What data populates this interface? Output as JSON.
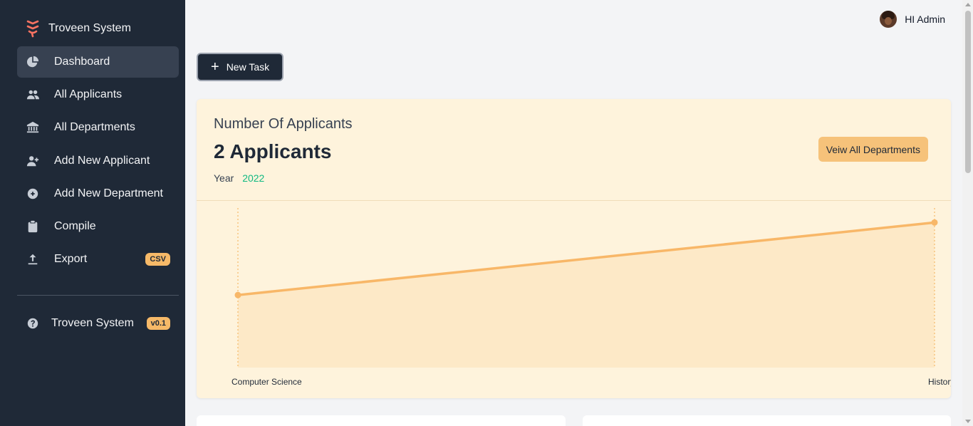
{
  "brand": {
    "name": "Troveen System",
    "logo_icon": "troveen-logo-icon"
  },
  "sidebar": {
    "items": [
      {
        "label": "Dashboard",
        "icon": "pie-chart-icon",
        "active": true
      },
      {
        "label": "All Applicants",
        "icon": "users-icon"
      },
      {
        "label": "All Departments",
        "icon": "bank-icon"
      },
      {
        "label": "Add New Applicant",
        "icon": "user-plus-icon"
      },
      {
        "label": "Add New Department",
        "icon": "plus-circle-icon"
      },
      {
        "label": "Compile",
        "icon": "clipboard-icon"
      },
      {
        "label": "Export",
        "icon": "upload-icon",
        "badge": "CSV"
      }
    ],
    "footer": {
      "label": "Troveen System",
      "badge": "v0.1",
      "icon": "help-icon"
    }
  },
  "topbar": {
    "greeting": "HI Admin"
  },
  "toolbar": {
    "new_task_label": "New Task"
  },
  "summary": {
    "title": "Number Of Applicants",
    "value": "2 Applicants",
    "year_label": "Year",
    "year": "2022",
    "view_button": "Veiw All Departments"
  },
  "colors": {
    "sidebar": "#1f2937",
    "accent": "#f6b968",
    "card_bg": "#fef3dc",
    "year_green": "#10b981"
  },
  "chart_data": {
    "type": "area",
    "categories": [
      "Computer Science",
      "History"
    ],
    "series": [
      {
        "values": [
          1,
          2
        ]
      }
    ],
    "ylim": [
      0,
      2.2
    ],
    "grid": false
  }
}
